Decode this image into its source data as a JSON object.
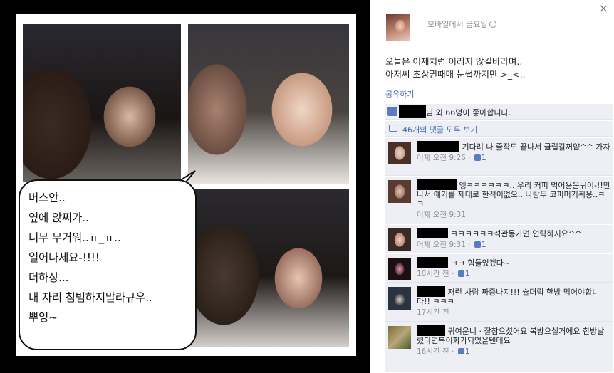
{
  "photo": {
    "bubble_lines": [
      "버스안..",
      "옆에 앉찌가..",
      "너무 무거워..ㅠ_ㅠ..",
      "일어나세요-!!!!",
      "더하상...",
      "내 자리 침범하지말라규우..",
      "뿌잉~"
    ]
  },
  "panel": {
    "close_glyph": "×",
    "poster_meta": "모바일에서 금요일",
    "post_text": [
      "오늘은 어제처럼 이러지 않길바라며..",
      "아저씨 초상권때매 눈썹까지만 >_<.."
    ],
    "share_label": "공유하기",
    "likes_text": "님 외 66명이 좋아합니다.",
    "comments_link": "46개의 댓글 모두 보기",
    "comments": [
      {
        "text": "기다려 나 줄작도 끝나서 클럽갈꺼얌^^ 가자",
        "time": "어제 오전 9:26",
        "likes": "1",
        "avatar_color": "#c8a090"
      },
      {
        "text": "엥ㅋㅋㅋㅋㅋㅋ.. 우리 커피 먹어용운뉘이-!!만나서 얘기를 제대로 한적이없오.. 나랑두 코피머거줘용..ㅋㅋ",
        "time": "어제 오전 9:31",
        "likes": "",
        "avatar_color": "#a07868"
      },
      {
        "text": "ㅋㅋㅋㅋㅋㅋ석관동가면 연락하지요^^",
        "time": "어제 오전 9:31",
        "likes": "1",
        "avatar_color": "#b8887a"
      },
      {
        "text": "ㅋㅋ 힘들었겠다~",
        "time": "18시간 전",
        "likes": "1",
        "avatar_color": "#5a2a3a"
      },
      {
        "text": "저런 사람 짜증나지!!! 슐더릭 한방 먹어야합니다!! ㅋㅋㅋ",
        "time": "17시간 전",
        "likes": "",
        "avatar_color": "#3a4a5a"
      },
      {
        "text": "귀여운너 · 잘참으셨어요 복방으실거에요 한방날렸다면복이화가되었을텐데요",
        "time": "16시간 전",
        "likes": "1",
        "avatar_color": "#7a6a3a"
      }
    ],
    "time_sep": " · ",
    "like_label": "좋아요"
  }
}
